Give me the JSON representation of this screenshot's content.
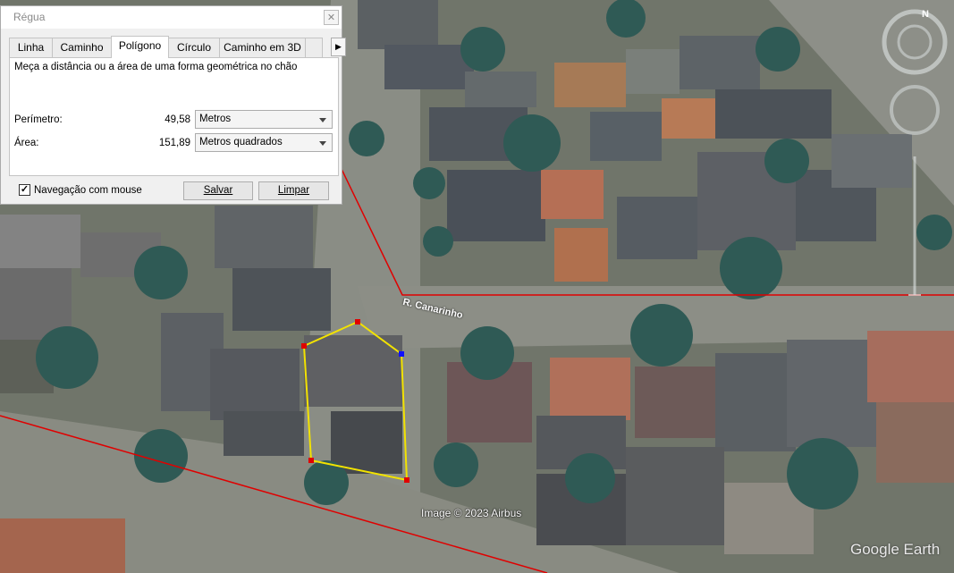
{
  "dialog": {
    "title": "Régua",
    "close_symbol": "✕",
    "tabs": [
      {
        "label": "Linha"
      },
      {
        "label": "Caminho"
      },
      {
        "label": "Polígono",
        "active": true
      },
      {
        "label": "Círculo"
      },
      {
        "label": "Caminho em 3D"
      }
    ],
    "tab_scroll_icon": "chevron-right-icon",
    "description": "Meça a distância ou a área de uma forma geométrica no chão",
    "perimeter": {
      "label": "Perímetro:",
      "value": "49,58",
      "unit": "Metros"
    },
    "area": {
      "label": "Área:",
      "value": "151,89",
      "unit": "Metros quadrados"
    },
    "mouse_navigation": {
      "label": "Navegação com mouse",
      "checked": true
    },
    "save_label": "Salvar",
    "clear_label": "Limpar"
  },
  "map": {
    "street_label": "R. Canarinho",
    "copyright": "Image © 2023 Airbus",
    "logo": "Google Earth",
    "compass_north": "N",
    "polygon_color": "#f2e200",
    "boundary_color": "#e00000",
    "vertex_colors": [
      "#e00000",
      "#1010ff"
    ]
  }
}
